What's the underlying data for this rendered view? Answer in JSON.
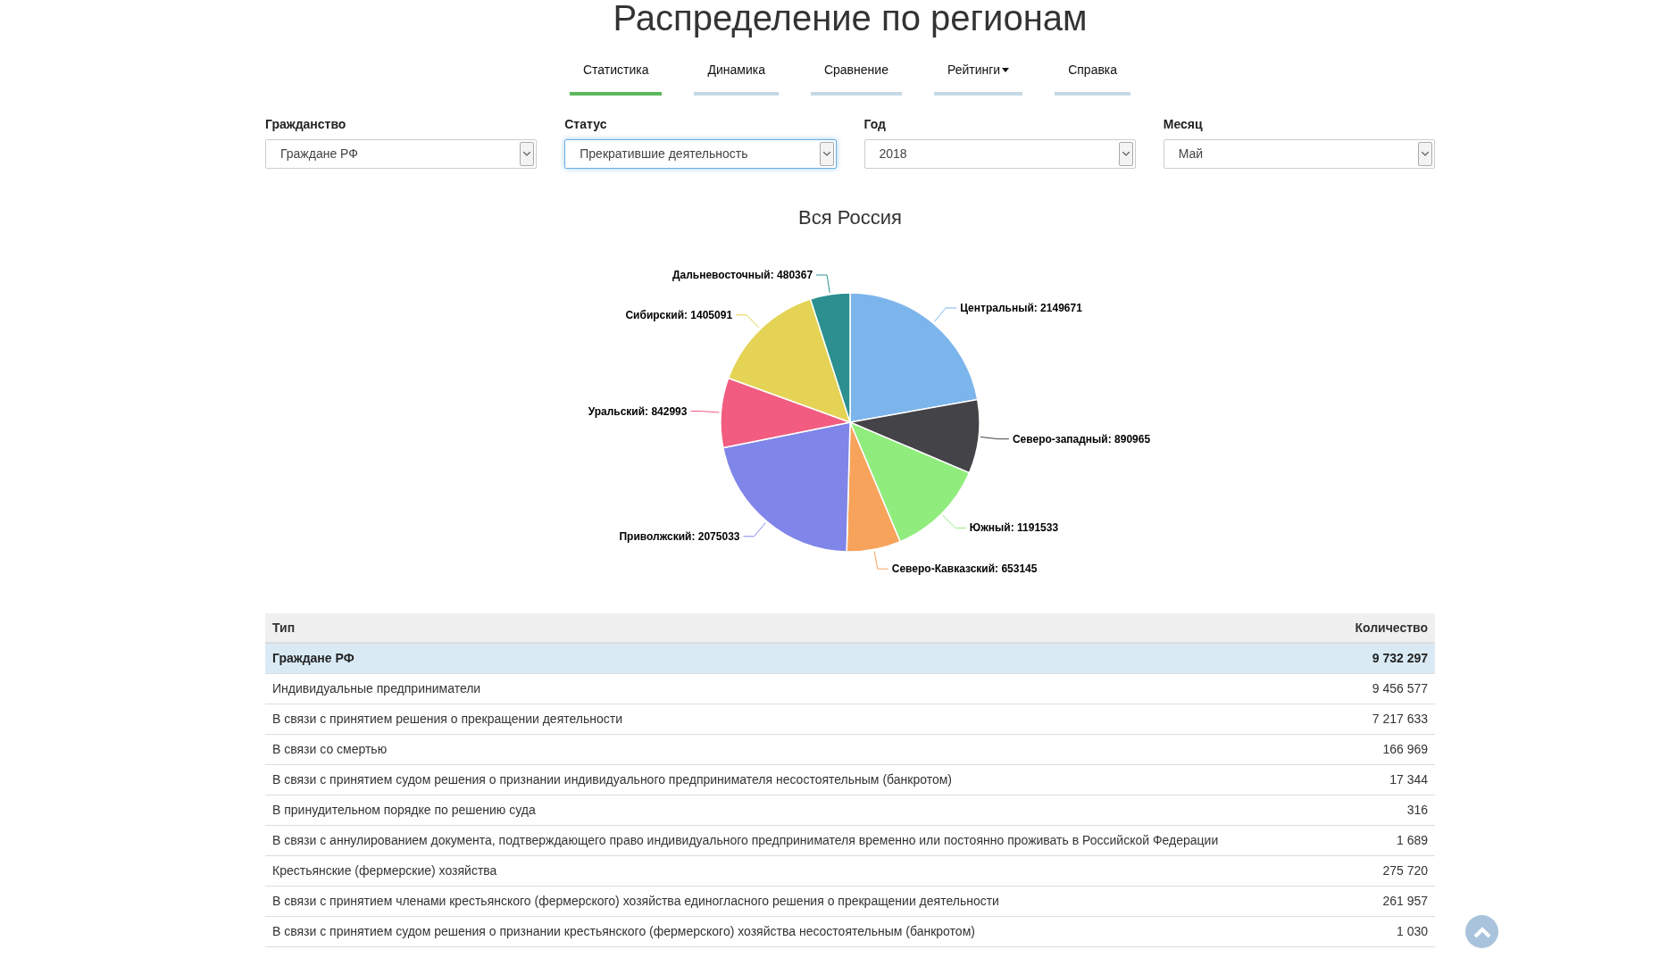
{
  "page_title": "Распределение по регионам",
  "tabs": [
    {
      "label": "Статистика",
      "selected": true,
      "dropdown": false
    },
    {
      "label": "Динамика",
      "selected": false,
      "dropdown": false
    },
    {
      "label": "Сравнение",
      "selected": false,
      "dropdown": false
    },
    {
      "label": "Рейтинги",
      "selected": false,
      "dropdown": true
    },
    {
      "label": "Справка",
      "selected": false,
      "dropdown": false
    }
  ],
  "filters": [
    {
      "label": "Гражданство",
      "value": "Граждане РФ",
      "focused": false
    },
    {
      "label": "Статус",
      "value": "Прекратившие деятельность",
      "focused": true
    },
    {
      "label": "Год",
      "value": "2018",
      "focused": false
    },
    {
      "label": "Месяц",
      "value": "Май",
      "focused": false
    }
  ],
  "chart": {
    "chart_data": {
      "type": "pie",
      "title": "Вся Россия",
      "value_labels": [
        "Центральный: 2149671",
        "Северо-западный: 890965",
        "Южный: 1191533",
        "Северо-Кавказский: 653145",
        "Приволжский: 2075033",
        "Уральский: 842993",
        "Сибирский: 1405091",
        "Дальневосточный: 480367"
      ],
      "values": [
        2149671,
        890965,
        1191533,
        653145,
        2075033,
        842993,
        1405091,
        480367
      ],
      "colors": [
        "#7cb5ec",
        "#434348",
        "#90ed7d",
        "#f7a35c",
        "#8085e9",
        "#f15c80",
        "#e4d354",
        "#2b908f"
      ]
    }
  },
  "table": {
    "columns": [
      "Тип",
      "Количество"
    ],
    "rows": [
      {
        "kind": "total",
        "type": "Граждане РФ",
        "count": "9 732 297"
      },
      {
        "kind": "item",
        "type": "Индивидуальные предприниматели",
        "count": "9 456 577"
      },
      {
        "kind": "item",
        "type": "В связи с принятием решения о прекращении деятельности",
        "count": "7 217 633"
      },
      {
        "kind": "item",
        "type": "В связи со смертью",
        "count": "166 969"
      },
      {
        "kind": "item",
        "type": "В связи с принятием судом решения о признании индивидуального предпринимателя несостоятельным (банкротом)",
        "count": "17 344"
      },
      {
        "kind": "item",
        "type": "В принудительном порядке по решению суда",
        "count": "316"
      },
      {
        "kind": "item",
        "type": "В связи с аннулированием документа, подтверждающего право индивидуального предпринимателя временно или постоянно проживать в Российской Федерации",
        "count": "1 689"
      },
      {
        "kind": "item",
        "type": "Крестьянские (фермерские) хозяйства",
        "count": "275 720"
      },
      {
        "kind": "item",
        "type": "В связи с принятием членами крестьянского (фермерского) хозяйства единогласного решения о прекращении деятельности",
        "count": "261 957"
      },
      {
        "kind": "item",
        "type": "В связи с принятием судом решения о признании крестьянского (фермерского) хозяйства несостоятельным (банкротом)",
        "count": "1 030"
      }
    ]
  }
}
